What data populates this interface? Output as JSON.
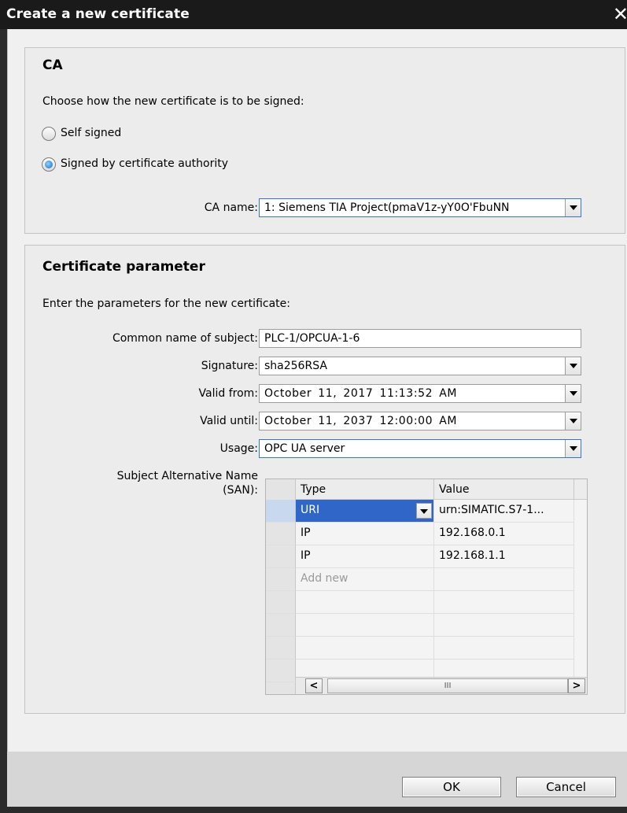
{
  "dialog": {
    "title": "Create a new certificate",
    "close_glyph": "✕"
  },
  "ca": {
    "heading": "CA",
    "prompt": "Choose how the new certificate is to be signed:",
    "options": [
      "Self signed",
      "Signed by certificate authority"
    ],
    "selected_option": "Signed by certificate authority",
    "ca_name_label": "CA name:",
    "ca_name_value": "1: Siemens TIA Project(pmaV1z-yY0O'FbuNN"
  },
  "certificate": {
    "heading": "Certificate parameter",
    "prompt": "Enter the parameters for the new certificate:",
    "common_name_label": "Common name of subject:",
    "common_name_value": "PLC-1/OPCUA-1-6",
    "signature_label": "Signature:",
    "signature_value": "sha256RSA",
    "valid_from_label": "Valid from:",
    "valid_from_value": "October 11, 2017 11:13:52 AM",
    "valid_until_label": "Valid until:",
    "valid_until_value": "October 11, 2037 12:00:00 AM",
    "usage_label": "Usage:",
    "usage_value": "OPC UA server",
    "san_label_line1": "Subject Alternative Name",
    "san_label_line2": "(SAN):",
    "san_table": {
      "columns": [
        "Type",
        "Value"
      ],
      "rows": [
        {
          "type": "URI",
          "value": "urn:SIMATIC.S7-1...",
          "selected": true
        },
        {
          "type": "IP",
          "value": "192.168.0.1",
          "selected": false
        },
        {
          "type": "IP",
          "value": "192.168.1.1",
          "selected": false
        }
      ],
      "add_new_placeholder": "Add new",
      "scroll_left_glyph": "<",
      "scroll_right_glyph": ">",
      "scroll_thumb_glyph": "III"
    }
  },
  "buttons": {
    "ok": "OK",
    "cancel": "Cancel"
  },
  "colors": {
    "titlebar": "#1a1a1a",
    "selection": "#2f66c7",
    "dropdown_border": "#3a73c9"
  }
}
